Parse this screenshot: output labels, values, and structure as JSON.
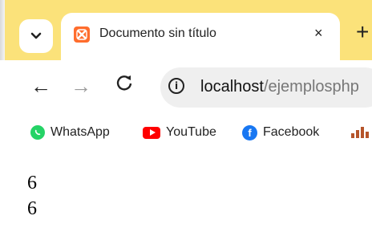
{
  "browser": {
    "tab": {
      "title": "Documento sin título",
      "close": "×",
      "new_tab": "+",
      "favicon_color": "#ff6d2d"
    },
    "tabstrip_color": "#fbe27a",
    "nav": {
      "back": "←",
      "forward": "→",
      "reload": "C"
    },
    "omnibox": {
      "host": "localhost",
      "path": "/ejemplosphp"
    },
    "bookmarks": [
      {
        "label": "WhatsApp",
        "icon": "whatsapp-icon"
      },
      {
        "label": "YouTube",
        "icon": "youtube-icon"
      },
      {
        "label": "Facebook",
        "icon": "facebook-icon"
      }
    ]
  },
  "page": {
    "lines": [
      "6",
      "6"
    ]
  }
}
